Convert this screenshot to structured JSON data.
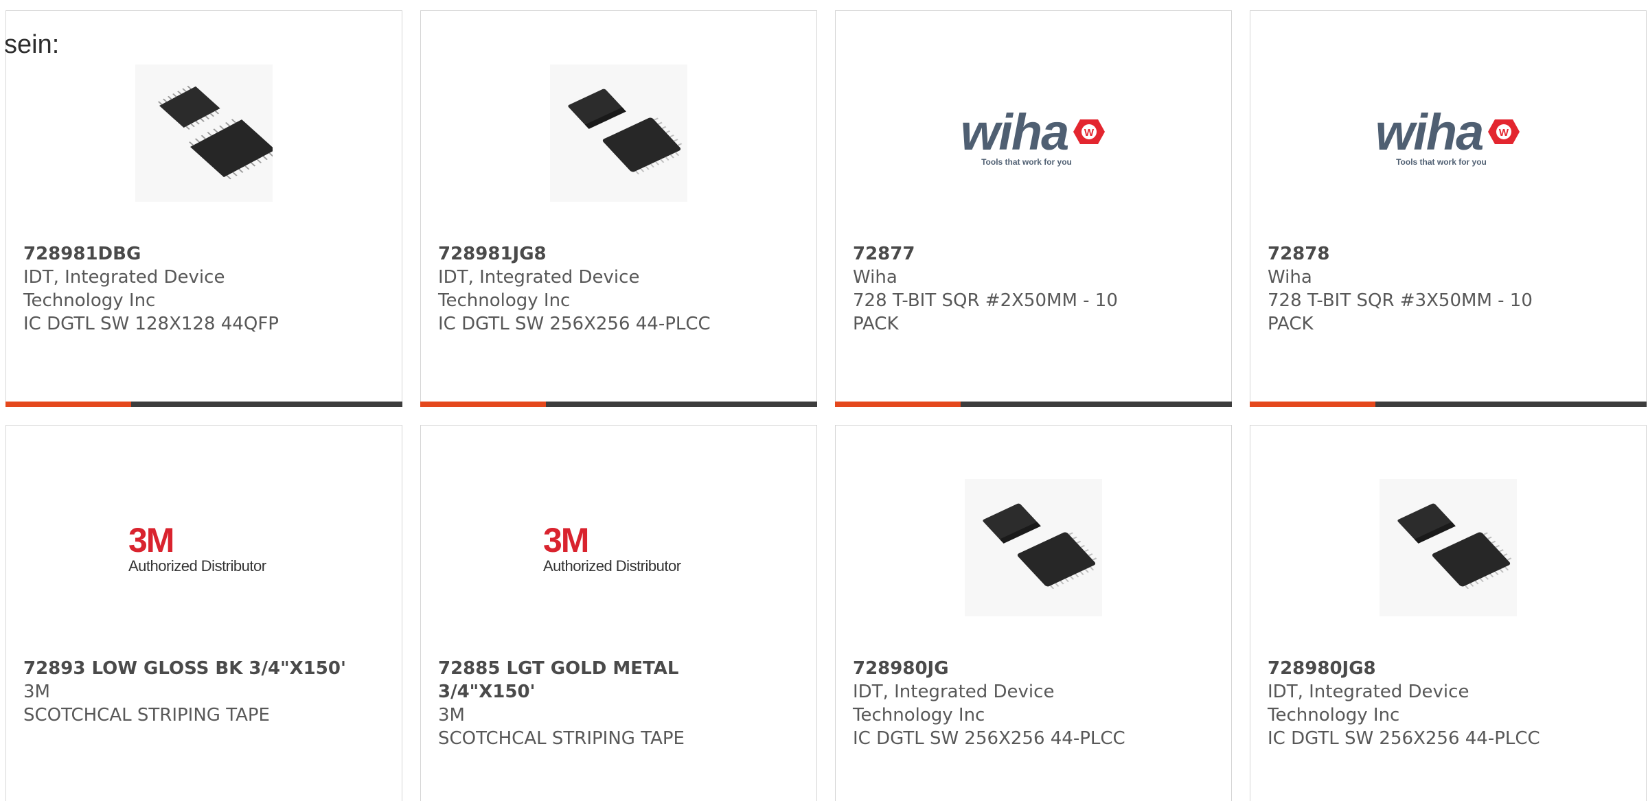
{
  "intro_text": "sein:",
  "colors": {
    "accent": "#e4481d",
    "bar": "#3d3d3d"
  },
  "products": [
    {
      "part": "728981DBG",
      "manufacturer": "IDT, Integrated Device Technology Inc",
      "description": "IC DGTL SW 128X128 44QFP",
      "image": "qfp-chip-image"
    },
    {
      "part": "728981JG8",
      "manufacturer": "IDT, Integrated Device Technology Inc",
      "description": "IC DGTL SW 256X256 44-PLCC",
      "image": "plcc-chip-image"
    },
    {
      "part": "72877",
      "manufacturer": "Wiha",
      "description": "728 T-BIT SQR #2X50MM - 10 PACK",
      "image": "wiha-logo",
      "logo_word": "wiha",
      "logo_tagline": "Tools that work for you"
    },
    {
      "part": "72878",
      "manufacturer": "Wiha",
      "description": "728 T-BIT SQR #3X50MM - 10 PACK",
      "image": "wiha-logo",
      "logo_word": "wiha",
      "logo_tagline": "Tools that work for you"
    },
    {
      "part": "72893 LOW GLOSS BK 3/4\"X150'",
      "manufacturer": "3M",
      "description": "SCOTCHCAL STRIPING TAPE",
      "image": "3m-logo",
      "logo_word": "3M",
      "logo_tagline": "Authorized Distributor"
    },
    {
      "part": "72885 LGT GOLD METAL 3/4\"X150'",
      "manufacturer": "3M",
      "description": "SCOTCHCAL STRIPING TAPE",
      "image": "3m-logo",
      "logo_word": "3M",
      "logo_tagline": "Authorized Distributor"
    },
    {
      "part": "728980JG",
      "manufacturer": "IDT, Integrated Device Technology Inc",
      "description": "IC DGTL SW 256X256 44-PLCC",
      "image": "plcc-chip-image"
    },
    {
      "part": "728980JG8",
      "manufacturer": "IDT, Integrated Device Technology Inc",
      "description": "IC DGTL SW 256X256 44-PLCC",
      "image": "plcc-chip-image"
    }
  ]
}
